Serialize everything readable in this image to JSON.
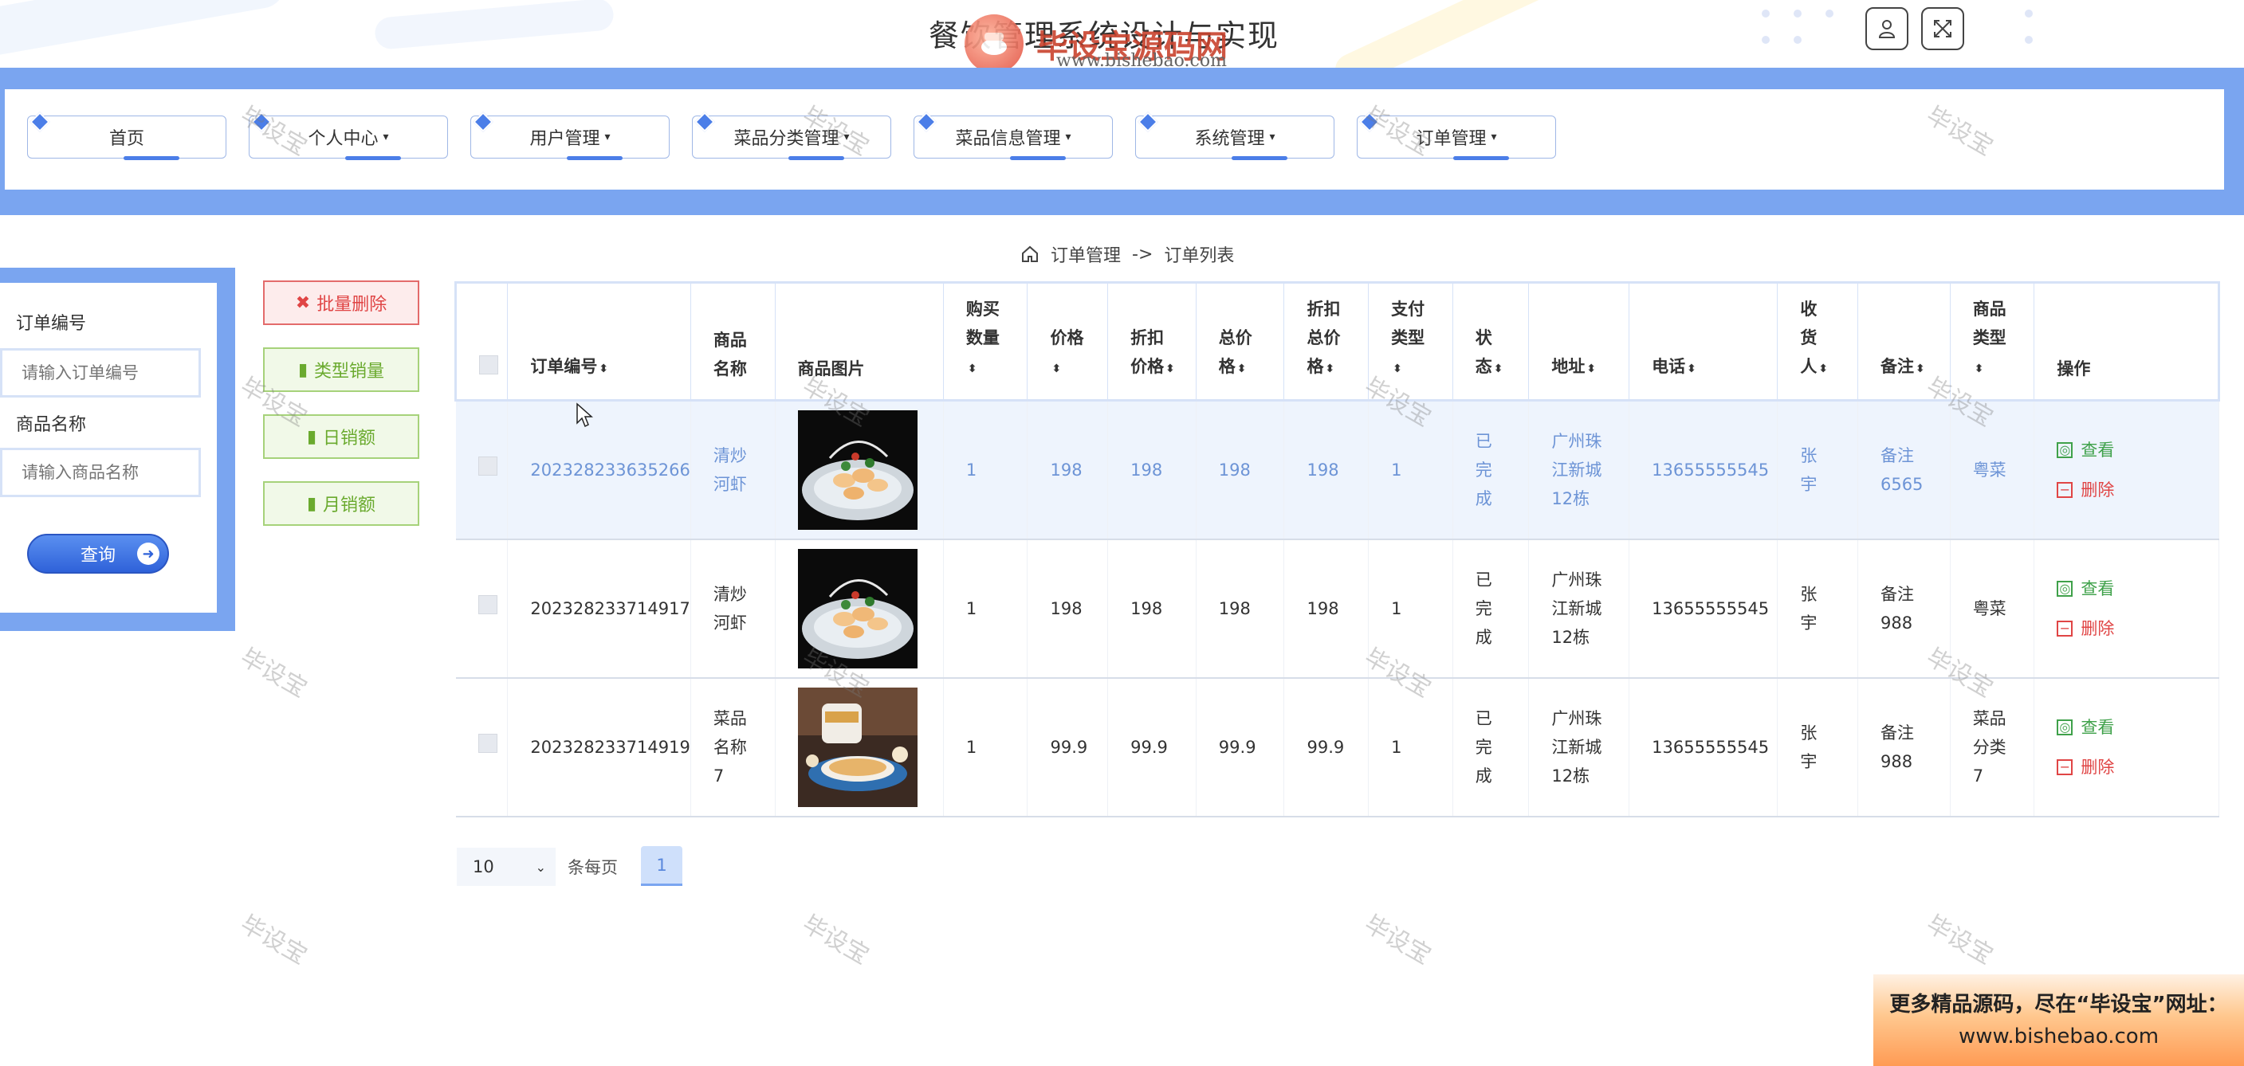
{
  "header": {
    "title": "餐饮管理系统设计与实现",
    "watermark_brand": "毕设宝源码网",
    "watermark_url": "www.bishebao.com"
  },
  "nav": {
    "items": [
      {
        "label": "首页",
        "dropdown": false
      },
      {
        "label": "个人中心",
        "dropdown": true
      },
      {
        "label": "用户管理",
        "dropdown": true
      },
      {
        "label": "菜品分类管理",
        "dropdown": true
      },
      {
        "label": "菜品信息管理",
        "dropdown": true
      },
      {
        "label": "系统管理",
        "dropdown": true
      },
      {
        "label": "订单管理",
        "dropdown": true
      }
    ],
    "caret": "▾"
  },
  "breadcrumb": {
    "root": "订单管理",
    "separator": "->",
    "current": "订单列表"
  },
  "search": {
    "order_no_label": "订单编号",
    "order_no_placeholder": "请输入订单编号",
    "product_name_label": "商品名称",
    "product_name_placeholder": "请输入商品名称",
    "query_label": "查询"
  },
  "actions": {
    "batch_delete": "批量删除",
    "category_sales": "类型销量",
    "daily_sales": "日销额",
    "monthly_sales": "月销额"
  },
  "table": {
    "headers": [
      "订单编号",
      "商品\n名称",
      "商品图片",
      "购买\n数量",
      "价格",
      "折扣\n价格",
      "总价\n格",
      "折扣\n总价\n格",
      "支付\n类型",
      "状\n态",
      "地址",
      "电话",
      "收\n货\n人",
      "备注",
      "商品\n类型",
      "操作"
    ],
    "rows": [
      {
        "order_no": "202328233635266",
        "product_name": "清炒\n河虾",
        "qty": "1",
        "price": "198",
        "discount_price": "198",
        "total": "198",
        "discount_total": "198",
        "pay_type": "1",
        "status": "已\n完\n成",
        "address": "广州珠\n江新城\n12栋",
        "phone": "13655555545",
        "receiver": "张\n宇",
        "remark": "备注\n6565",
        "category": "粤菜",
        "highlight": true,
        "image": "shrimp"
      },
      {
        "order_no": "202328233714917",
        "product_name": "清炒\n河虾",
        "qty": "1",
        "price": "198",
        "discount_price": "198",
        "total": "198",
        "discount_total": "198",
        "pay_type": "1",
        "status": "已\n完\n成",
        "address": "广州珠\n江新城\n12栋",
        "phone": "13655555545",
        "receiver": "张\n宇",
        "remark": "备注\n988",
        "category": "粤菜",
        "highlight": false,
        "image": "shrimp"
      },
      {
        "order_no": "202328233714919",
        "product_name": "菜品\n名称\n7",
        "qty": "1",
        "price": "99.9",
        "discount_price": "99.9",
        "total": "99.9",
        "discount_total": "99.9",
        "pay_type": "1",
        "status": "已\n完\n成",
        "address": "广州珠\n江新城\n12栋",
        "phone": "13655555545",
        "receiver": "张\n宇",
        "remark": "备注\n988",
        "category": "菜品\n分类\n7",
        "highlight": false,
        "image": "soup"
      }
    ],
    "view_label": "查看",
    "delete_label": "删除"
  },
  "pagination": {
    "page_size": "10",
    "per_page_label": "条每页",
    "current_page": "1"
  },
  "promo": {
    "line1": "更多精品源码，尽在“毕设宝”网址：",
    "line2": "www.bishebao.com"
  },
  "watermark_text": "毕设宝",
  "colors": {
    "accent": "#7aa5f0",
    "view": "#3fa14a",
    "delete": "#e04545",
    "highlight_text": "#6d94d6"
  }
}
